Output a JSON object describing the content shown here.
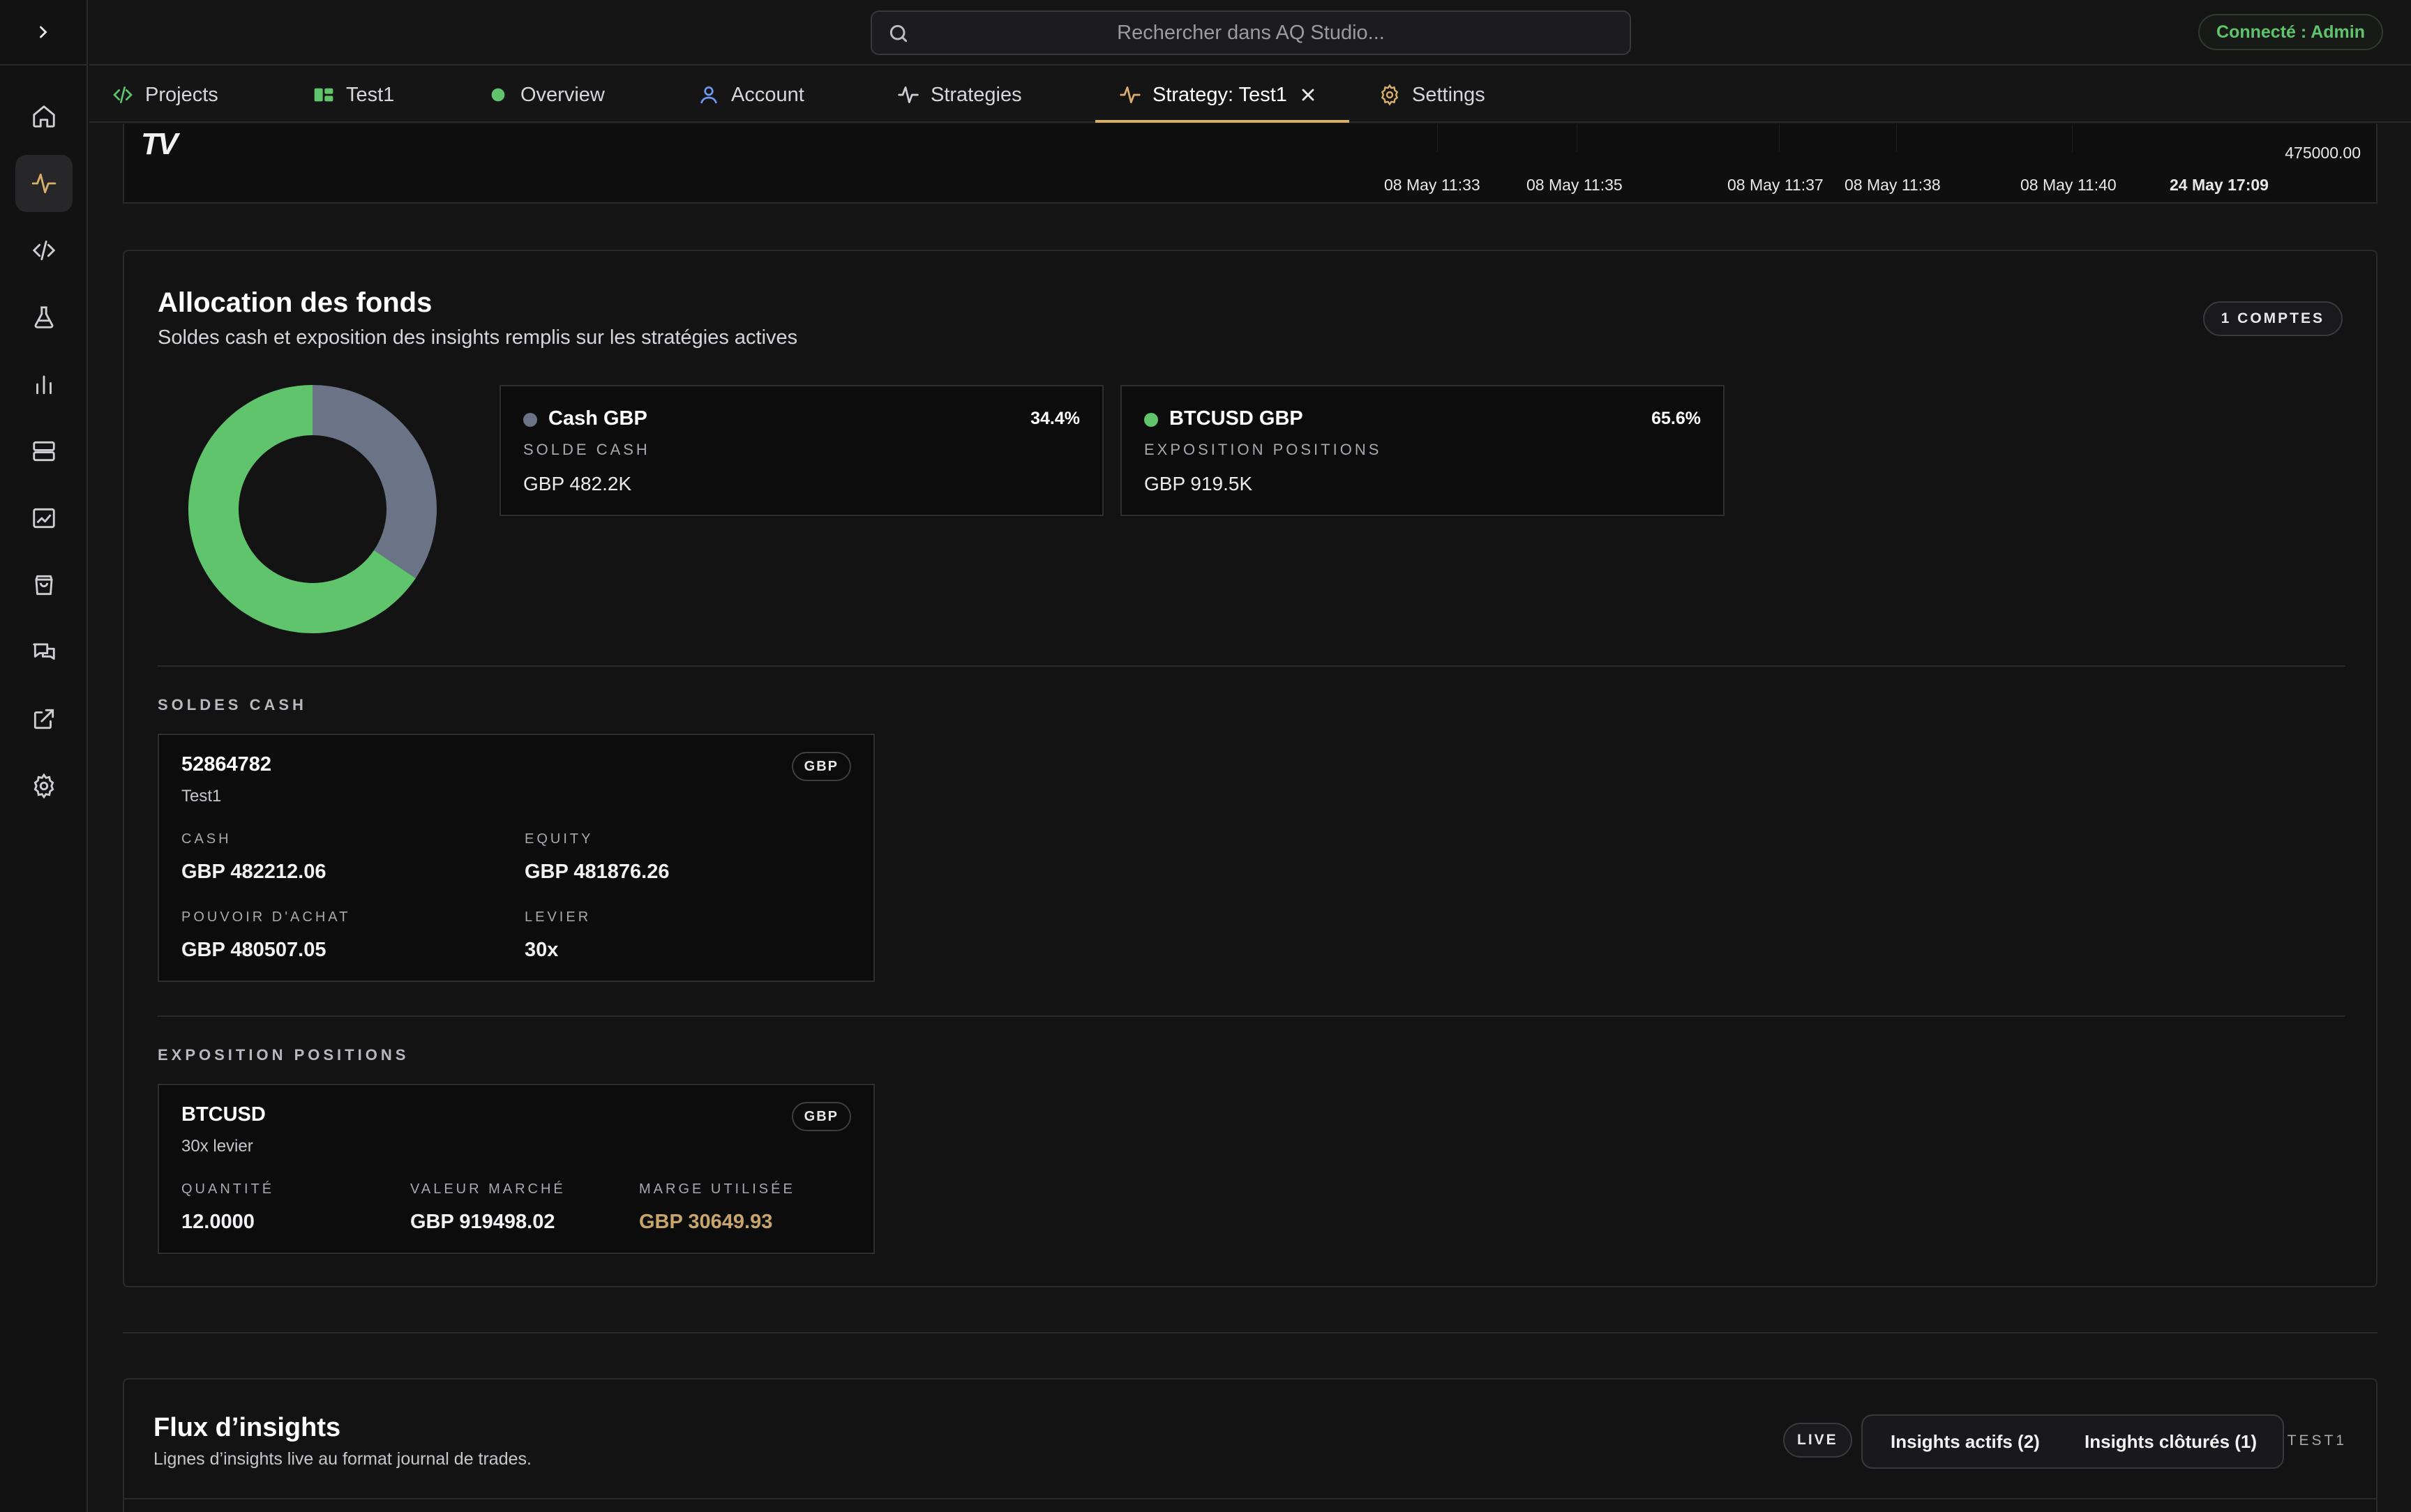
{
  "app": {
    "search_placeholder": "Rechercher dans AQ Studio...",
    "status": "Connecté : Admin"
  },
  "tabs": [
    {
      "label": "Projects",
      "icon": "code-icon"
    },
    {
      "label": "Test1",
      "icon": "project-icon"
    },
    {
      "label": "Overview",
      "icon": "status-dot-icon"
    },
    {
      "label": "Account",
      "icon": "user-icon"
    },
    {
      "label": "Strategies",
      "icon": "activity-icon"
    },
    {
      "label": "Strategy: Test1",
      "icon": "activity-icon",
      "active": true
    },
    {
      "label": "Settings",
      "icon": "gear-icon"
    }
  ],
  "sidebar": {
    "items": [
      {
        "icon": "home-icon"
      },
      {
        "icon": "activity-icon",
        "active": true
      },
      {
        "icon": "code-icon"
      },
      {
        "icon": "flask-icon"
      },
      {
        "icon": "bar-chart-icon"
      },
      {
        "icon": "server-icon"
      },
      {
        "icon": "line-chart-icon"
      },
      {
        "icon": "shopping-bag-icon"
      },
      {
        "icon": "chat-icon"
      },
      {
        "icon": "external-link-icon"
      },
      {
        "icon": "gear-icon"
      }
    ]
  },
  "price_chart": {
    "price_label": "475000.00",
    "time_labels": [
      "08 May 11:33",
      "08 May 11:35",
      "08 May 11:37",
      "08 May 11:38",
      "08 May 11:40",
      "24 May 17:09"
    ]
  },
  "allocation": {
    "title": "Allocation des fonds",
    "subtitle": "Soldes cash et exposition des insights remplis sur les stratégies actives",
    "accounts_badge": "1 COMPTES",
    "donut": [
      {
        "name": "Cash GBP",
        "percent": 34.4,
        "color": "#6b7487"
      },
      {
        "name": "BTCUSD GBP",
        "percent": 65.6,
        "color": "#5fc46b"
      }
    ],
    "boxes": [
      {
        "name": "Cash GBP",
        "pct": "34.4%",
        "sub": "SOLDE CASH",
        "value": "GBP 482.2K",
        "color": "#6b7487"
      },
      {
        "name": "BTCUSD GBP",
        "pct": "65.6%",
        "sub": "EXPOSITION POSITIONS",
        "value": "GBP 919.5K",
        "color": "#5fc46b"
      }
    ],
    "cash_section": "SOLDES CASH",
    "cash_account": {
      "id": "52864782",
      "name": "Test1",
      "currency": "GBP",
      "cash_label": "CASH",
      "cash": "GBP 482212.06",
      "equity_label": "EQUITY",
      "equity": "GBP 481876.26",
      "bp_label": "POUVOIR D'ACHAT",
      "bp": "GBP 480507.05",
      "lev_label": "LEVIER",
      "lev": "30x"
    },
    "positions_section": "EXPOSITION POSITIONS",
    "position": {
      "symbol": "BTCUSD",
      "leverage": "30x levier",
      "currency": "GBP",
      "qty_label": "QUANTITÉ",
      "qty": "12.0000",
      "mv_label": "VALEUR MARCHÉ",
      "mv": "GBP 919498.02",
      "margin_label": "MARGE UTILISÉE",
      "margin": "GBP 30649.93"
    }
  },
  "insights": {
    "title": "Flux d’insights",
    "subtitle": "Lignes d’insights live au format journal de trades.",
    "live": "LIVE",
    "active_btn": "Insights actifs (2)",
    "closed_btn": "Insights clôturés (1)",
    "tag": "TEST1"
  }
}
